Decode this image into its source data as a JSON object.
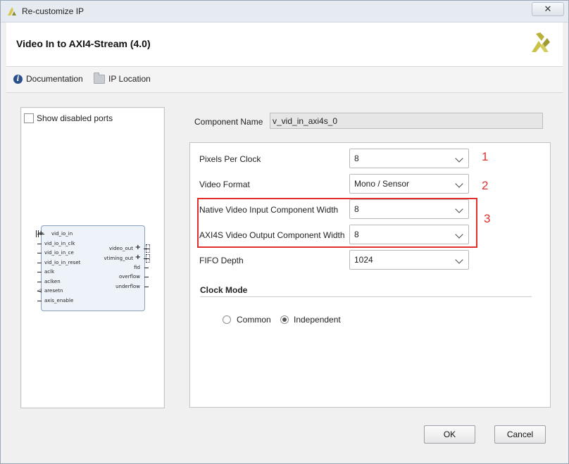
{
  "window": {
    "title": "Re-customize IP",
    "close_symbol": "✕"
  },
  "header": {
    "title": "Video In to AXI4-Stream (4.0)"
  },
  "toolbar": {
    "documentation": "Documentation",
    "ip_location": "IP Location"
  },
  "left_panel": {
    "show_disabled_ports": "Show disabled ports",
    "show_disabled_ports_checked": false,
    "ip_symbol": {
      "left_ports": [
        "vid_io_in",
        "vid_io_in_clk",
        "vid_io_in_ce",
        "vid_io_in_reset",
        "aclk",
        "aclken",
        "aresetn",
        "axis_enable"
      ],
      "right_ports": [
        "video_out",
        "vtiming_out",
        "fid",
        "overflow",
        "underflow"
      ]
    }
  },
  "component": {
    "label": "Component Name",
    "value": "v_vid_in_axi4s_0"
  },
  "params": [
    {
      "label": "Pixels Per Clock",
      "value": "8",
      "annotation": "1"
    },
    {
      "label": "Video Format",
      "value": "Mono / Sensor",
      "annotation": "2"
    },
    {
      "label": "Native Video Input Component Width",
      "value": "8",
      "annotation": "3"
    },
    {
      "label": "AXI4S Video Output Component Width",
      "value": "8",
      "annotation": ""
    },
    {
      "label": "FIFO Depth",
      "value": "1024",
      "annotation": ""
    }
  ],
  "clock_mode": {
    "title": "Clock Mode",
    "options": [
      "Common",
      "Independent"
    ],
    "selected": "Independent"
  },
  "buttons": {
    "ok": "OK",
    "cancel": "Cancel"
  },
  "colors": {
    "annotation_red": "#e0302e",
    "logo_yellow": "#c8c24a",
    "ip_block_fill": "#eef3fa"
  }
}
